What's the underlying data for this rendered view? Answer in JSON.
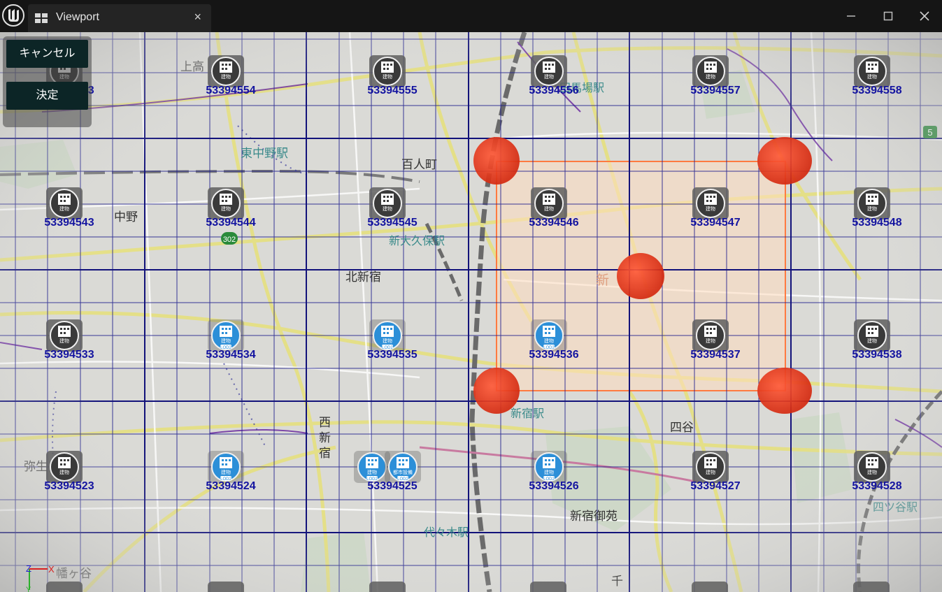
{
  "window": {
    "tab_title": "Viewport",
    "tab_close_glyph": "×",
    "minimize_glyph": "—",
    "maximize_glyph": "☐",
    "close_glyph": "✕"
  },
  "panel": {
    "cancel_label": "キャンセル",
    "decide_label": "決定"
  },
  "map_labels": {
    "station_nakano_higashi": "東中野駅",
    "hyakunincho": "百人町",
    "nakano": "中野",
    "shin_okubo": "新大久保駅",
    "kita_shinjuku": "北新宿",
    "nishi_shinjuku": "西\n新\n宿",
    "yotsuya": "四谷",
    "shinjuku_gyoen": "新宿御苑",
    "yoyogi": "代々木駅",
    "babashita": "田馬場駅",
    "yotsuya_station": "四ツ谷駅",
    "kamitaka": "上高",
    "shinjuku": "新",
    "shinjuku_station": "新宿駅",
    "yayoi": "弥生",
    "hatagaya": "幡ヶ谷",
    "sen": "千"
  },
  "tiles": [
    {
      "code": "53394553",
      "icons": [
        "gray"
      ]
    },
    {
      "code": "53394554",
      "icons": [
        "gray"
      ]
    },
    {
      "code": "53394555",
      "icons": [
        "gray"
      ]
    },
    {
      "code": "53394556",
      "icons": [
        "gray"
      ]
    },
    {
      "code": "53394557",
      "icons": [
        "gray"
      ]
    },
    {
      "code": "53394558",
      "icons": [
        "gray"
      ]
    },
    {
      "code": "53394543",
      "icons": [
        "gray"
      ]
    },
    {
      "code": "53394544",
      "icons": [
        "gray"
      ]
    },
    {
      "code": "53394545",
      "icons": [
        "gray"
      ]
    },
    {
      "code": "53394546",
      "icons": [
        "gray"
      ]
    },
    {
      "code": "53394547",
      "icons": [
        "gray"
      ]
    },
    {
      "code": "53394548",
      "icons": [
        "gray"
      ]
    },
    {
      "code": "53394533",
      "icons": [
        "gray"
      ]
    },
    {
      "code": "53394534",
      "icons": [
        "blue"
      ]
    },
    {
      "code": "53394535",
      "icons": [
        "blue"
      ]
    },
    {
      "code": "53394536",
      "icons": [
        "blue"
      ]
    },
    {
      "code": "53394537",
      "icons": [
        "gray"
      ]
    },
    {
      "code": "53394538",
      "icons": [
        "gray"
      ]
    },
    {
      "code": "53394523",
      "icons": [
        "gray"
      ]
    },
    {
      "code": "53394524",
      "icons": [
        "blue"
      ]
    },
    {
      "code": "53394525",
      "icons": [
        "blue",
        "blue-urban"
      ]
    },
    {
      "code": "53394526",
      "icons": [
        "blue"
      ]
    },
    {
      "code": "53394527",
      "icons": [
        "gray"
      ]
    },
    {
      "code": "53394528",
      "icons": [
        "gray"
      ]
    }
  ],
  "icon_text": {
    "building": "建物",
    "lod2": "LOD2",
    "urban": "都市設備"
  },
  "gizmo": {
    "z": "Z",
    "x": "X",
    "y": "Y"
  },
  "route_badges": {
    "r5": "5",
    "r302": "302"
  },
  "colors": {
    "grid_line": "#1a1a8c",
    "selection_fill": "#ffdcc0",
    "selection_stroke": "#ff7a40",
    "handle": "#e83018",
    "tile_label": "#1414a0",
    "button_bg": "#0c2526",
    "titlebar": "#151515"
  }
}
